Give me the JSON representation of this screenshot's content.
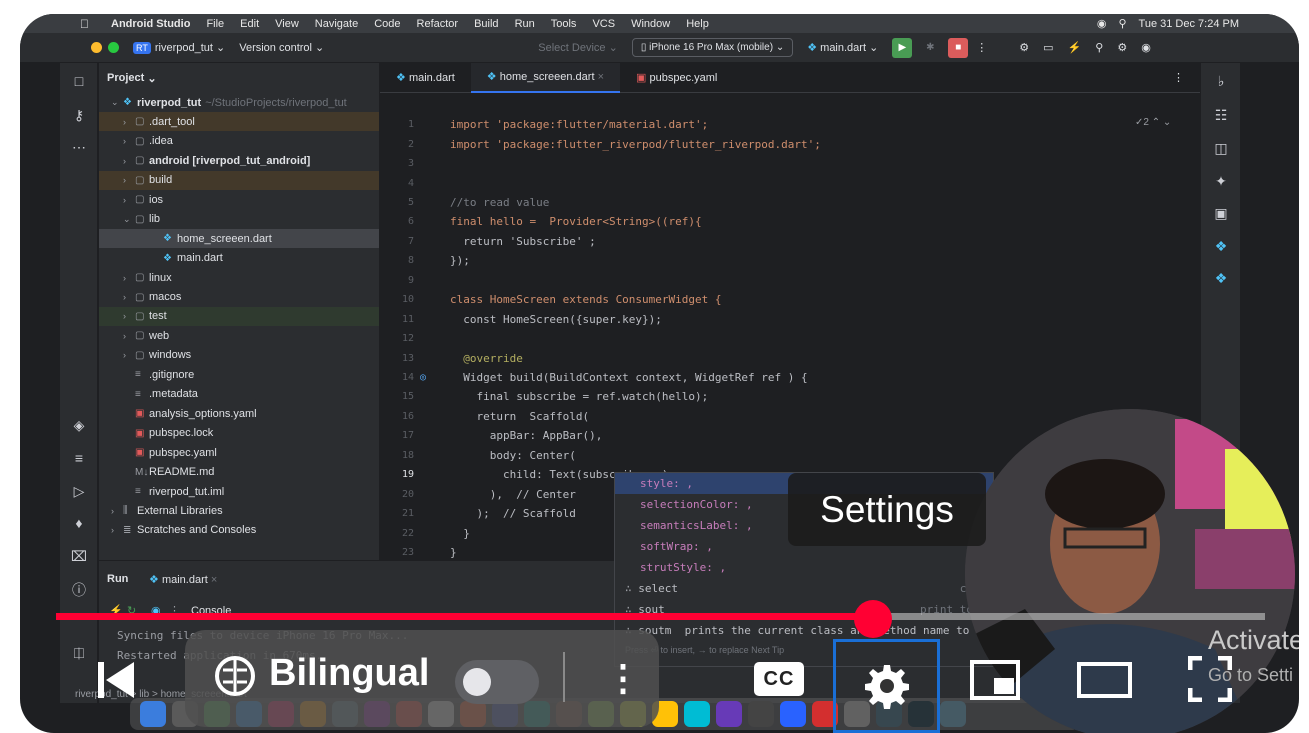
{
  "menubar": {
    "app": "Android Studio",
    "items": [
      "File",
      "Edit",
      "View",
      "Navigate",
      "Code",
      "Refactor",
      "Build",
      "Run",
      "Tools",
      "VCS",
      "Window",
      "Help"
    ],
    "clock": "Tue 31 Dec  7:24 PM"
  },
  "titlebar": {
    "project_badge": "RT",
    "project": "riverpod_tut",
    "version_control": "Version control",
    "select_device": "Select Device",
    "device": "iPhone 16 Pro Max (mobile)",
    "run_config": "main.dart"
  },
  "project_panel": {
    "header": "Project",
    "rows": [
      {
        "label": "riverpod_tut",
        "suffix": "~/StudioProjects/riverpod_tut",
        "arrow": "⌄",
        "icon": "flutter"
      },
      {
        "label": ".dart_tool",
        "arrow": "›",
        "icon": "folder",
        "hl": "or"
      },
      {
        "label": ".idea",
        "arrow": "›",
        "icon": "folder"
      },
      {
        "label": "android [riverpod_tut_android]",
        "arrow": "›",
        "icon": "folder"
      },
      {
        "label": "build",
        "arrow": "›",
        "icon": "folder",
        "hl": "or"
      },
      {
        "label": "ios",
        "arrow": "›",
        "icon": "folder"
      },
      {
        "label": "lib",
        "arrow": "⌄",
        "icon": "folder"
      },
      {
        "label": "home_screeen.dart",
        "arrow": "",
        "icon": "dart",
        "sel": true
      },
      {
        "label": "main.dart",
        "arrow": "",
        "icon": "dart"
      },
      {
        "label": "linux",
        "arrow": "›",
        "icon": "folder"
      },
      {
        "label": "macos",
        "arrow": "›",
        "icon": "folder"
      },
      {
        "label": "test",
        "arrow": "›",
        "icon": "folder",
        "hl": "gr"
      },
      {
        "label": "web",
        "arrow": "›",
        "icon": "folder"
      },
      {
        "label": "windows",
        "arrow": "›",
        "icon": "folder"
      },
      {
        "label": ".gitignore",
        "arrow": "",
        "icon": "file"
      },
      {
        "label": ".metadata",
        "arrow": "",
        "icon": "file"
      },
      {
        "label": "analysis_options.yaml",
        "arrow": "",
        "icon": "yaml"
      },
      {
        "label": "pubspec.lock",
        "arrow": "",
        "icon": "yaml"
      },
      {
        "label": "pubspec.yaml",
        "arrow": "",
        "icon": "yaml"
      },
      {
        "label": "README.md",
        "arrow": "",
        "icon": "md"
      },
      {
        "label": "riverpod_tut.iml",
        "arrow": "",
        "icon": "file"
      },
      {
        "label": "External Libraries",
        "arrow": "›",
        "icon": "lib"
      },
      {
        "label": "Scratches and Consoles",
        "arrow": "›",
        "icon": "scratch"
      }
    ]
  },
  "editor": {
    "tabs": [
      "main.dart",
      "home_screeen.dart",
      "pubspec.yaml"
    ],
    "active_tab": 1,
    "inspection": "✓2",
    "lines": [
      "import 'package:flutter/material.dart';",
      "import 'package:flutter_riverpod/flutter_riverpod.dart';",
      "",
      "",
      "//to read value",
      "final hello =  Provider<String>((ref){",
      "  return 'Subscribe' ;",
      "});",
      "",
      "class HomeScreen extends ConsumerWidget {",
      "  const HomeScreen({super.key});",
      "",
      "  @override",
      "  Widget build(BuildContext context, WidgetRef ref ) {",
      "    final subscribe = ref.watch(hello);",
      "    return  Scaffold(",
      "      appBar: AppBar(),",
      "      body: Center(",
      "        child: Text(subscribe ,s),",
      "      ),  // Center",
      "    );  // Scaffold",
      "  }",
      "}"
    ]
  },
  "autocomplete": {
    "items": [
      "style: ,",
      "selectionColor: ,",
      "semanticsLabel: ,",
      "softWrap: ,",
      "strutStyle: ,",
      "select",
      "sout",
      "soutm  prints the current class and method name to"
    ],
    "footer": "Press ⏎ to insert, → to replace  Next Tip",
    "hint1": "co",
    "hint2": "print to"
  },
  "run_panel": {
    "run_label": "Run",
    "run_tab": "main.dart",
    "console": "Console",
    "out1": "Syncing files to device iPhone 16 Pro Max...",
    "out2": "Restarted application in 670ms.",
    "breadcrumb": "riverpod_tut > lib > home_screeen.dart"
  },
  "player": {
    "tooltip": "Settings",
    "bilingual_label": "Bilingual",
    "toggle_on": false,
    "cc_label": "CC",
    "progress_fraction": 0.686,
    "played_color": "#ff0033"
  },
  "watermark": {
    "line1": "Activate",
    "line2": "Go to Setti"
  }
}
